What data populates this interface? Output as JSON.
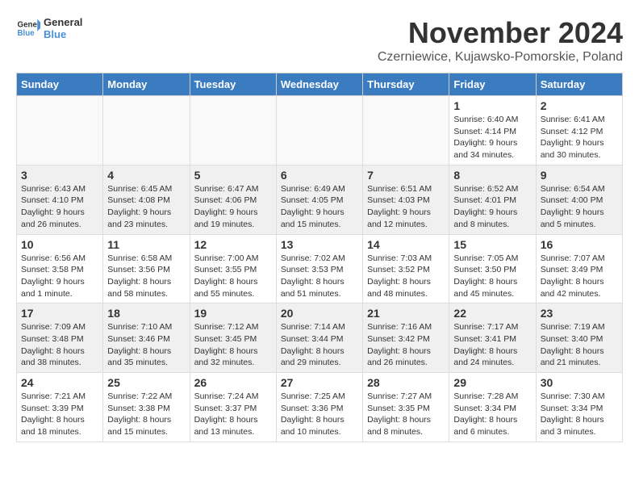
{
  "header": {
    "logo_general": "General",
    "logo_blue": "Blue",
    "month_title": "November 2024",
    "location": "Czerniewice, Kujawsko-Pomorskie, Poland"
  },
  "weekdays": [
    "Sunday",
    "Monday",
    "Tuesday",
    "Wednesday",
    "Thursday",
    "Friday",
    "Saturday"
  ],
  "weeks": [
    [
      {
        "day": "",
        "info": "",
        "empty": true
      },
      {
        "day": "",
        "info": "",
        "empty": true
      },
      {
        "day": "",
        "info": "",
        "empty": true
      },
      {
        "day": "",
        "info": "",
        "empty": true
      },
      {
        "day": "",
        "info": "",
        "empty": true
      },
      {
        "day": "1",
        "info": "Sunrise: 6:40 AM\nSunset: 4:14 PM\nDaylight: 9 hours\nand 34 minutes."
      },
      {
        "day": "2",
        "info": "Sunrise: 6:41 AM\nSunset: 4:12 PM\nDaylight: 9 hours\nand 30 minutes."
      }
    ],
    [
      {
        "day": "3",
        "info": "Sunrise: 6:43 AM\nSunset: 4:10 PM\nDaylight: 9 hours\nand 26 minutes."
      },
      {
        "day": "4",
        "info": "Sunrise: 6:45 AM\nSunset: 4:08 PM\nDaylight: 9 hours\nand 23 minutes."
      },
      {
        "day": "5",
        "info": "Sunrise: 6:47 AM\nSunset: 4:06 PM\nDaylight: 9 hours\nand 19 minutes."
      },
      {
        "day": "6",
        "info": "Sunrise: 6:49 AM\nSunset: 4:05 PM\nDaylight: 9 hours\nand 15 minutes."
      },
      {
        "day": "7",
        "info": "Sunrise: 6:51 AM\nSunset: 4:03 PM\nDaylight: 9 hours\nand 12 minutes."
      },
      {
        "day": "8",
        "info": "Sunrise: 6:52 AM\nSunset: 4:01 PM\nDaylight: 9 hours\nand 8 minutes."
      },
      {
        "day": "9",
        "info": "Sunrise: 6:54 AM\nSunset: 4:00 PM\nDaylight: 9 hours\nand 5 minutes."
      }
    ],
    [
      {
        "day": "10",
        "info": "Sunrise: 6:56 AM\nSunset: 3:58 PM\nDaylight: 9 hours\nand 1 minute."
      },
      {
        "day": "11",
        "info": "Sunrise: 6:58 AM\nSunset: 3:56 PM\nDaylight: 8 hours\nand 58 minutes."
      },
      {
        "day": "12",
        "info": "Sunrise: 7:00 AM\nSunset: 3:55 PM\nDaylight: 8 hours\nand 55 minutes."
      },
      {
        "day": "13",
        "info": "Sunrise: 7:02 AM\nSunset: 3:53 PM\nDaylight: 8 hours\nand 51 minutes."
      },
      {
        "day": "14",
        "info": "Sunrise: 7:03 AM\nSunset: 3:52 PM\nDaylight: 8 hours\nand 48 minutes."
      },
      {
        "day": "15",
        "info": "Sunrise: 7:05 AM\nSunset: 3:50 PM\nDaylight: 8 hours\nand 45 minutes."
      },
      {
        "day": "16",
        "info": "Sunrise: 7:07 AM\nSunset: 3:49 PM\nDaylight: 8 hours\nand 42 minutes."
      }
    ],
    [
      {
        "day": "17",
        "info": "Sunrise: 7:09 AM\nSunset: 3:48 PM\nDaylight: 8 hours\nand 38 minutes."
      },
      {
        "day": "18",
        "info": "Sunrise: 7:10 AM\nSunset: 3:46 PM\nDaylight: 8 hours\nand 35 minutes."
      },
      {
        "day": "19",
        "info": "Sunrise: 7:12 AM\nSunset: 3:45 PM\nDaylight: 8 hours\nand 32 minutes."
      },
      {
        "day": "20",
        "info": "Sunrise: 7:14 AM\nSunset: 3:44 PM\nDaylight: 8 hours\nand 29 minutes."
      },
      {
        "day": "21",
        "info": "Sunrise: 7:16 AM\nSunset: 3:42 PM\nDaylight: 8 hours\nand 26 minutes."
      },
      {
        "day": "22",
        "info": "Sunrise: 7:17 AM\nSunset: 3:41 PM\nDaylight: 8 hours\nand 24 minutes."
      },
      {
        "day": "23",
        "info": "Sunrise: 7:19 AM\nSunset: 3:40 PM\nDaylight: 8 hours\nand 21 minutes."
      }
    ],
    [
      {
        "day": "24",
        "info": "Sunrise: 7:21 AM\nSunset: 3:39 PM\nDaylight: 8 hours\nand 18 minutes."
      },
      {
        "day": "25",
        "info": "Sunrise: 7:22 AM\nSunset: 3:38 PM\nDaylight: 8 hours\nand 15 minutes."
      },
      {
        "day": "26",
        "info": "Sunrise: 7:24 AM\nSunset: 3:37 PM\nDaylight: 8 hours\nand 13 minutes."
      },
      {
        "day": "27",
        "info": "Sunrise: 7:25 AM\nSunset: 3:36 PM\nDaylight: 8 hours\nand 10 minutes."
      },
      {
        "day": "28",
        "info": "Sunrise: 7:27 AM\nSunset: 3:35 PM\nDaylight: 8 hours\nand 8 minutes."
      },
      {
        "day": "29",
        "info": "Sunrise: 7:28 AM\nSunset: 3:34 PM\nDaylight: 8 hours\nand 6 minutes."
      },
      {
        "day": "30",
        "info": "Sunrise: 7:30 AM\nSunset: 3:34 PM\nDaylight: 8 hours\nand 3 minutes."
      }
    ]
  ]
}
